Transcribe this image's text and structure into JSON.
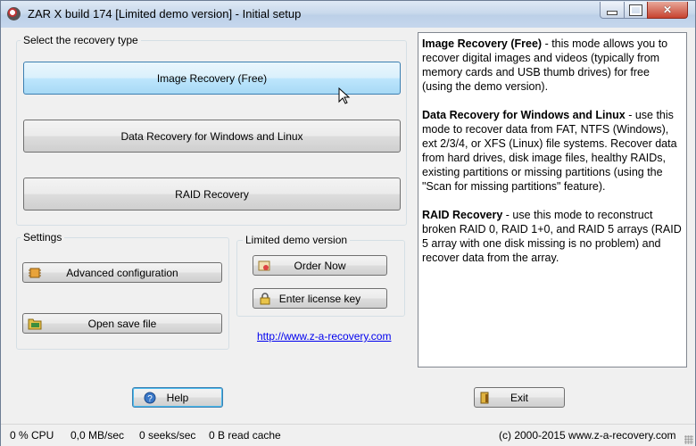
{
  "window": {
    "title": "ZAR X build 174 [Limited demo version] - Initial setup",
    "icon": "zar-app-icon"
  },
  "recovery": {
    "group_title": "Select the recovery type",
    "image_label": "Image Recovery (Free)",
    "data_label": "Data Recovery for Windows and Linux",
    "raid_label": "RAID Recovery"
  },
  "settings": {
    "group_title": "Settings",
    "advanced_label": "Advanced configuration",
    "open_label": "Open save file"
  },
  "demo": {
    "group_title": "Limited demo version",
    "order_label": "Order Now",
    "license_label": "Enter license key",
    "link": "http://www.z-a-recovery.com"
  },
  "info": {
    "p1_title": "Image Recovery (Free)",
    "p1_text": " - this mode allows you to recover digital images and videos (typically from memory cards and USB thumb drives) for free (using the demo version).",
    "p2_title": "Data Recovery for Windows and Linux",
    "p2_text": " - use this mode to recover data from FAT, NTFS (Windows), ext 2/3/4, or XFS (Linux) file systems. Recover data from hard drives, disk image files, healthy RAIDs, existing partitions or missing partitions (using the \"Scan for missing partitions\" feature).",
    "p3_title": "RAID Recovery",
    "p3_text": " - use this mode to reconstruct broken RAID 0, RAID 1+0, and RAID 5 arrays (RAID 5 array with one disk missing is no problem) and recover data from the array."
  },
  "footer": {
    "help_label": "Help",
    "exit_label": "Exit"
  },
  "status": {
    "cpu": "0 % CPU",
    "rate": "0,0 MB/sec",
    "seeks": "0 seeks/sec",
    "cache": "0 B read cache",
    "copyright": "(c) 2000-2015 www.z-a-recovery.com"
  },
  "colors": {
    "hover_accent": "#bee6fd",
    "link": "#0000ee"
  }
}
